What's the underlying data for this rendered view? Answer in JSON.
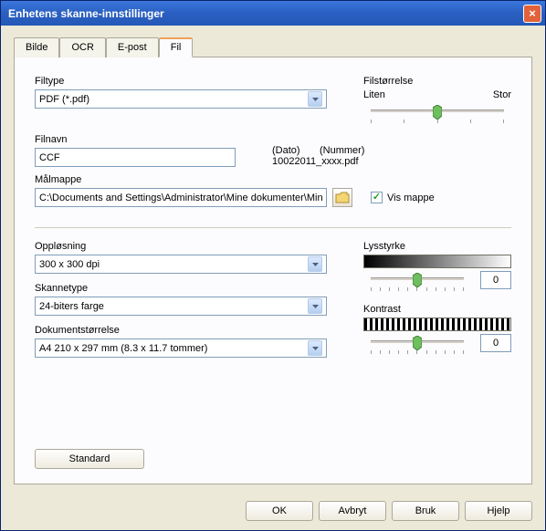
{
  "window": {
    "title": "Enhetens skanne-innstillinger"
  },
  "tabs": {
    "t0": "Bilde",
    "t1": "OCR",
    "t2": "E-post",
    "t3": "Fil"
  },
  "filetype": {
    "label": "Filtype",
    "value": "PDF (*.pdf)"
  },
  "filesize": {
    "label": "Filstørrelse",
    "small": "Liten",
    "large": "Stor"
  },
  "filename": {
    "label": "Filnavn",
    "value": "CCF"
  },
  "placeholders": {
    "date": "(Dato)",
    "number": "(Nummer)",
    "sample": "10022011_xxxx.pdf"
  },
  "destfolder": {
    "label": "Målmappe",
    "value": "C:\\Documents and Settings\\Administrator\\Mine dokumenter\\Min"
  },
  "showfolder": {
    "label": "Vis mappe"
  },
  "resolution": {
    "label": "Oppløsning",
    "value": "300 x 300 dpi"
  },
  "scantype": {
    "label": "Skannetype",
    "value": "24-biters farge"
  },
  "docsize": {
    "label": "Dokumentstørrelse",
    "value": "A4 210 x 297 mm (8.3 x 11.7 tommer)"
  },
  "brightness": {
    "label": "Lysstyrke",
    "value": "0"
  },
  "contrast": {
    "label": "Kontrast",
    "value": "0"
  },
  "buttons": {
    "default": "Standard",
    "ok": "OK",
    "cancel": "Avbryt",
    "apply": "Bruk",
    "help": "Hjelp"
  }
}
